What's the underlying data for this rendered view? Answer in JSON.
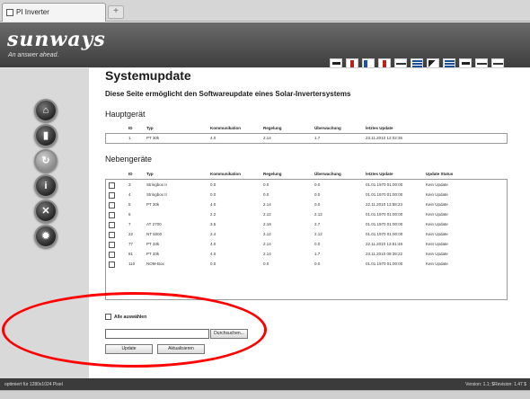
{
  "browser": {
    "tab_title": "PI Inverter",
    "new_tab": "+"
  },
  "header": {
    "logo": "sunways",
    "tagline": "An answer ahead.",
    "language_flags": [
      "lang-1",
      "lang-2",
      "lang-3",
      "lang-4",
      "lang-5",
      "lang-6",
      "lang-7",
      "lang-8",
      "lang-9",
      "lang-10",
      "lang-11"
    ]
  },
  "sidebar": {
    "items": [
      {
        "icon": "home-icon",
        "glyph": "⌂"
      },
      {
        "icon": "device-icon",
        "glyph": "▮"
      },
      {
        "icon": "update-icon",
        "glyph": "↻",
        "active": true
      },
      {
        "icon": "info-icon",
        "glyph": "i"
      },
      {
        "icon": "tools-icon",
        "glyph": "✕"
      },
      {
        "icon": "settings-icon",
        "glyph": "✹"
      }
    ]
  },
  "main": {
    "title": "Systemupdate",
    "subtitle": "Diese Seite ermöglicht den Softwareupdate eines Solar-Invertersystems",
    "hauptgeraet": {
      "heading": "Hauptgerät",
      "columns": [
        "ID",
        "Typ",
        "Kommunikation",
        "Regelung",
        "Überwachung",
        "letztes Update"
      ],
      "row": {
        "id": "1",
        "typ": "PT 30k",
        "komm": "4.0",
        "reg": "2.14",
        "ueb": "1.7",
        "upd": "23.11.2010 12:02:36"
      }
    },
    "nebengeraete": {
      "heading": "Nebengeräte",
      "columns": [
        "ID",
        "Typ",
        "Kommunikation",
        "Regelung",
        "Überwachung",
        "letztes Update",
        "Update Status"
      ],
      "rows": [
        {
          "id": "3",
          "typ": "Stringbox II",
          "komm": "0.0",
          "reg": "0.0",
          "ueb": "0.0",
          "upd": "01.01.1970 01:00:00",
          "stat": "Kein Update"
        },
        {
          "id": "4",
          "typ": "Stringbox II",
          "komm": "0.0",
          "reg": "0.0",
          "ueb": "0.0",
          "upd": "01.01.1970 01:00:00",
          "stat": "Kein Update"
        },
        {
          "id": "5",
          "typ": "PT 30k",
          "komm": "4.0",
          "reg": "2.14",
          "ueb": "0.0",
          "upd": "22.11.2010 13:58:23",
          "stat": "Kein Update"
        },
        {
          "id": "6",
          "typ": "",
          "komm": "2.2",
          "reg": "2.12",
          "ueb": "2.12",
          "upd": "01.01.1970 01:00:00",
          "stat": "Kein Update"
        },
        {
          "id": "7",
          "typ": "AT 2700",
          "komm": "3.5",
          "reg": "2.19",
          "ueb": "2.7",
          "upd": "01.01.1970 01:00:00",
          "stat": "Kein Update"
        },
        {
          "id": "22",
          "typ": "NT 5000",
          "komm": "2.4",
          "reg": "2.12",
          "ueb": "2.12",
          "upd": "01.01.1970 01:00:00",
          "stat": "Kein Update"
        },
        {
          "id": "77",
          "typ": "PT 33k",
          "komm": "4.0",
          "reg": "2.14",
          "ueb": "0.0",
          "upd": "22.11.2010 13:51:48",
          "stat": "Kein Update"
        },
        {
          "id": "81",
          "typ": "PT 33k",
          "komm": "4.0",
          "reg": "2.14",
          "ueb": "1.7",
          "upd": "23.11.2010 09:39:22",
          "stat": "Kein Update"
        },
        {
          "id": "110",
          "typ": "NOM-Box",
          "komm": "0.0",
          "reg": "0.0",
          "ueb": "0.0",
          "upd": "01.01.1970 01:00:00",
          "stat": "Kein Update"
        }
      ]
    },
    "select_all": "Alle auswählen",
    "browse": "Durchsuchen...",
    "update": "Update",
    "refresh": "Aktualisieren"
  },
  "footer": {
    "left": "optimiert für 1280x1024 Pixel",
    "right": "Version: 1.1; $Revision: 1.47 $"
  },
  "colors": {
    "header_dark": "#3e3e3e",
    "highlight": "#ff0000",
    "sidebar": "#d9d9d9"
  }
}
